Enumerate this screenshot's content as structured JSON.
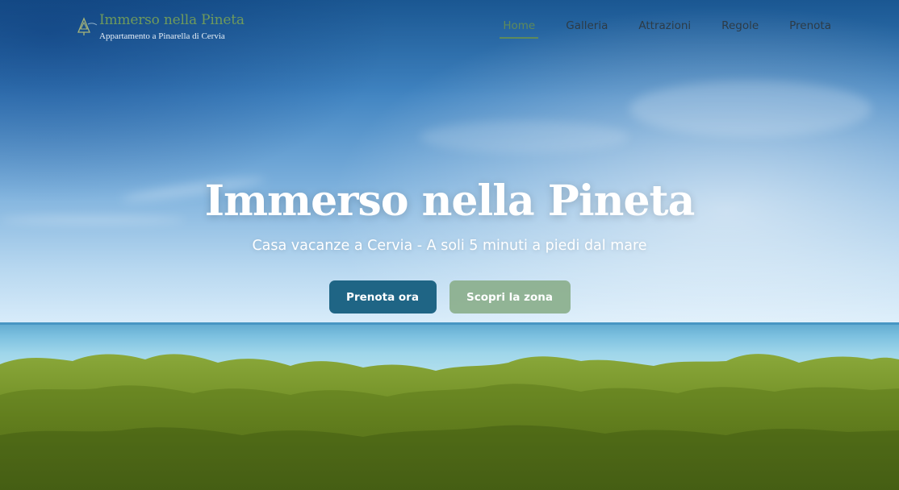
{
  "brand": {
    "title": "Immerso nella Pineta",
    "subtitle": "Appartamento a Pinarella di Cervia",
    "icon": "pine-tree-icon",
    "color": "#6f9a5c"
  },
  "nav": {
    "items": [
      {
        "label": "Home",
        "active": true
      },
      {
        "label": "Galleria",
        "active": false
      },
      {
        "label": "Attrazioni",
        "active": false
      },
      {
        "label": "Regole",
        "active": false
      },
      {
        "label": "Prenota",
        "active": false
      }
    ],
    "active_color": "#5f8a5a"
  },
  "hero": {
    "title": "Immerso nella Pineta",
    "subtitle": "Casa vacanze a Cervia - A soli 5 minuti a piedi dal mare",
    "primary_button": "Prenota ora",
    "secondary_button": "Scopri la zona",
    "primary_color": "#1f6585",
    "secondary_color": "#8baf8c"
  }
}
